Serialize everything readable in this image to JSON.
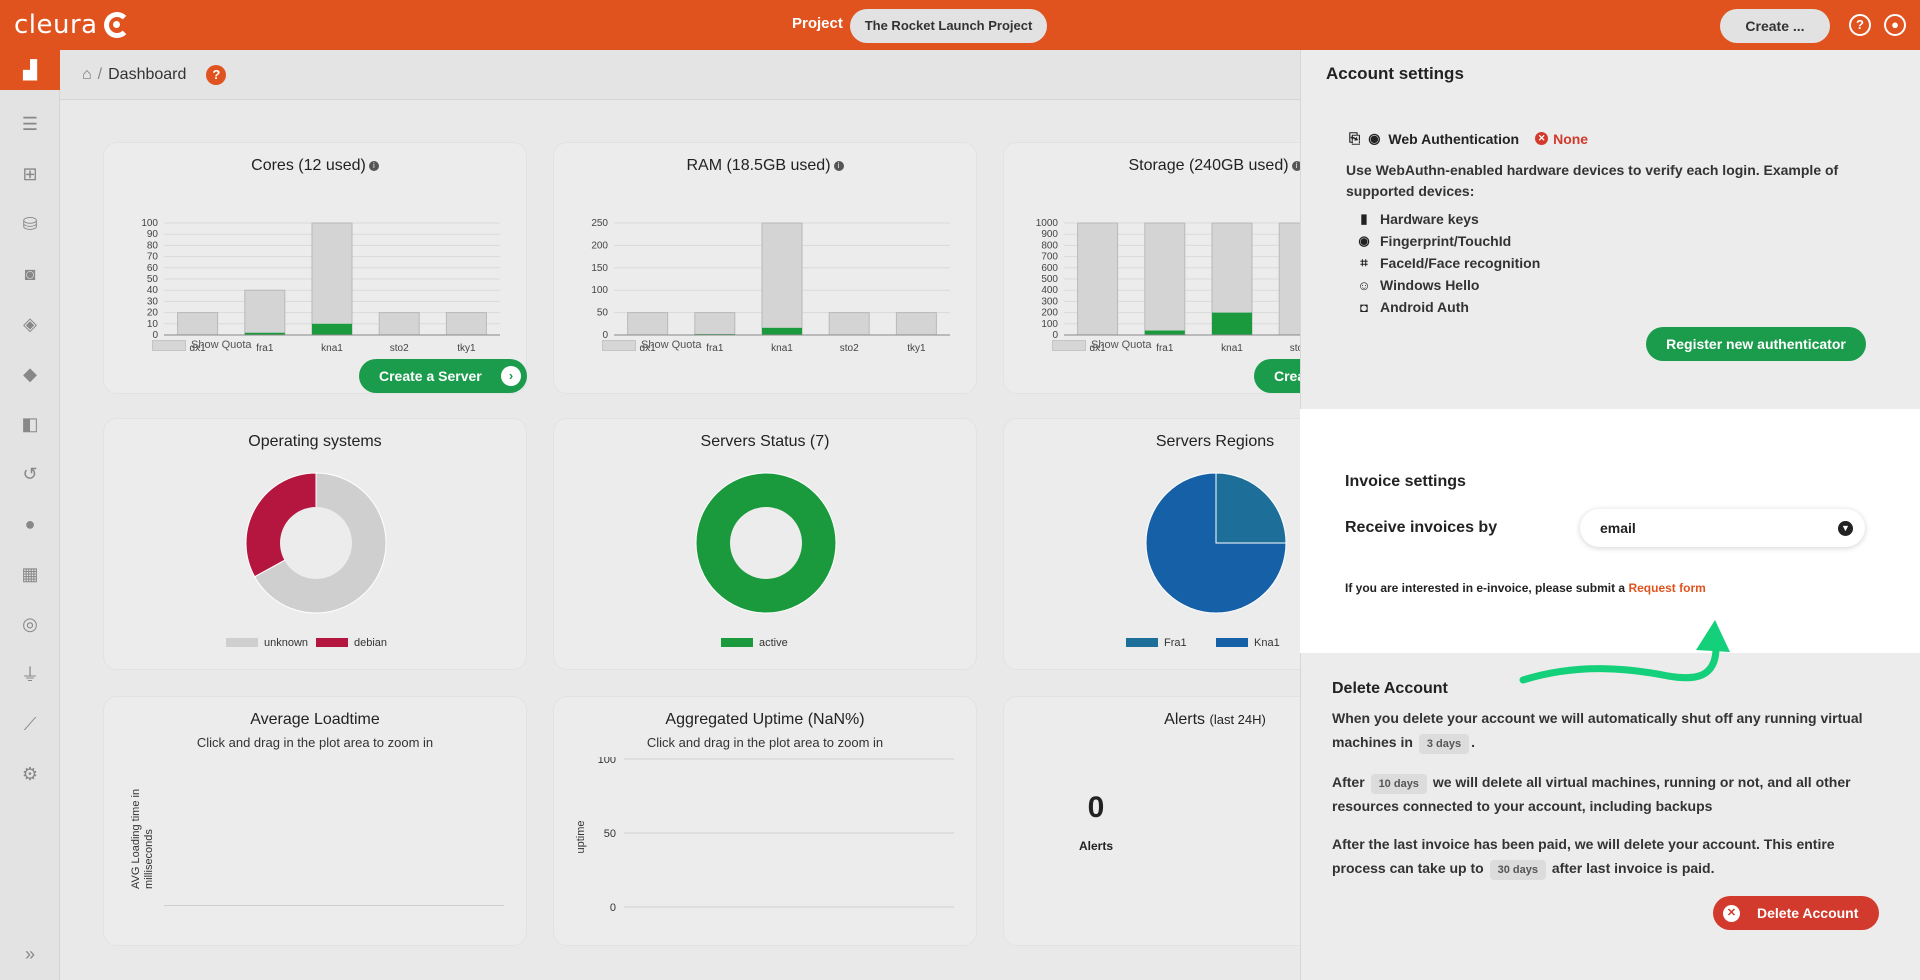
{
  "brand": {
    "name": "cleura",
    "accent": "#e0531f",
    "green": "#1b9c4d",
    "red": "#d13a2c"
  },
  "topbar": {
    "project_label": "Project",
    "project_name": "The Rocket Launch Project",
    "create_label": "Create ...",
    "icons": [
      "question-icon",
      "user-icon"
    ]
  },
  "sidebar": {
    "items": [
      {
        "icon": "dashboard-chart-icon",
        "active": true
      },
      {
        "icon": "servers-icon"
      },
      {
        "icon": "network-icon"
      },
      {
        "icon": "database-icon"
      },
      {
        "icon": "camera-icon"
      },
      {
        "icon": "shield-icon"
      },
      {
        "icon": "layers-icon"
      },
      {
        "icon": "box-icon"
      },
      {
        "icon": "history-icon"
      },
      {
        "icon": "user-icon"
      },
      {
        "icon": "calculator-icon"
      },
      {
        "icon": "lifebuoy-icon"
      },
      {
        "icon": "plug-icon"
      },
      {
        "icon": "chart-line-icon"
      },
      {
        "icon": "gear-icon"
      }
    ],
    "expand_icon": "double-chevron-right-icon"
  },
  "header": {
    "breadcrumb_sep": "/",
    "title": "Dashboard",
    "help": "?"
  },
  "cards": {
    "cores_title": "Cores (12 used)",
    "ram_title": "RAM (18.5GB used)",
    "storage_title": "Storage (240GB used)",
    "show_quota": "Show Quota",
    "create_server": "Create a Server",
    "os_title": "Operating systems",
    "os_legend": [
      "unknown",
      "debian"
    ],
    "status_title": "Servers Status (7)",
    "status_legend": [
      "active"
    ],
    "regions_title": "Servers Regions",
    "regions_legend": [
      "Fra1",
      "Kna1"
    ],
    "loadtime_title": "Average Loadtime",
    "zoom_hint": "Click and drag in the plot area to zoom in",
    "loadtime_ylabel": "AVG Loading time in milliseconds",
    "uptime_title": "Aggregated Uptime (NaN%)",
    "uptime_ylabel": "uptime",
    "alerts_title": "Alerts",
    "alerts_suffix": "(last 24H)",
    "alerts_value": "0",
    "alerts_label": "Alerts"
  },
  "chart_data": [
    {
      "type": "bar",
      "title": "Cores (12 used)",
      "categories": [
        "dx1",
        "fra1",
        "kna1",
        "sto2",
        "tky1"
      ],
      "series": [
        {
          "name": "Quota",
          "values": [
            20,
            40,
            100,
            20,
            20
          ]
        },
        {
          "name": "Used",
          "values": [
            0,
            2,
            10,
            0,
            0
          ]
        }
      ],
      "yticks": [
        0,
        10,
        20,
        30,
        40,
        50,
        60,
        70,
        80,
        90,
        100
      ],
      "ylim": [
        0,
        100
      ]
    },
    {
      "type": "bar",
      "title": "RAM (18.5GB used)",
      "categories": [
        "dx1",
        "fra1",
        "kna1",
        "sto2",
        "tky1"
      ],
      "series": [
        {
          "name": "Quota",
          "values": [
            50,
            50,
            250,
            50,
            50
          ]
        },
        {
          "name": "Used",
          "values": [
            0,
            2,
            16,
            0,
            0
          ]
        }
      ],
      "yticks": [
        0,
        50,
        100,
        150,
        200,
        250
      ],
      "ylim": [
        0,
        250
      ]
    },
    {
      "type": "bar",
      "title": "Storage (240GB used)",
      "categories": [
        "dx1",
        "fra1",
        "kna1",
        "sto2"
      ],
      "series": [
        {
          "name": "Quota",
          "values": [
            1000,
            1000,
            1000,
            1000
          ]
        },
        {
          "name": "Used",
          "values": [
            0,
            40,
            200,
            0
          ]
        }
      ],
      "yticks": [
        0,
        100,
        200,
        300,
        400,
        500,
        600,
        700,
        800,
        900,
        1000
      ],
      "ylim": [
        0,
        1000
      ]
    },
    {
      "type": "pie",
      "title": "Operating systems",
      "labels": [
        "unknown",
        "debian"
      ],
      "values": [
        67,
        33
      ],
      "colors": [
        "#cfcfcf",
        "#b5163f"
      ]
    },
    {
      "type": "pie",
      "title": "Servers Status (7)",
      "labels": [
        "active"
      ],
      "values": [
        100
      ],
      "colors": [
        "#1a9a3d"
      ]
    },
    {
      "type": "pie",
      "title": "Servers Regions",
      "labels": [
        "Fra1",
        "Kna1"
      ],
      "values": [
        25,
        75
      ],
      "colors": [
        "#1d6f9a",
        "#1660a8"
      ]
    },
    {
      "type": "line",
      "title": "Aggregated Uptime (NaN%)",
      "ylabel": "uptime",
      "yticks": [
        0,
        50,
        100
      ]
    }
  ],
  "panel": {
    "title": "Account settings",
    "webauthn_title": "Web Authentication",
    "webauthn_status": "None",
    "webauthn_desc": "Use WebAuthn-enabled hardware devices to verify each login. Example of supported devices:",
    "devices": [
      {
        "label": "Hardware keys",
        "icon": "usb-key-icon"
      },
      {
        "label": "Fingerprint/TouchId",
        "icon": "fingerprint-icon"
      },
      {
        "label": "FaceId/Face recognition",
        "icon": "face-scan-icon"
      },
      {
        "label": "Windows Hello",
        "icon": "smile-icon"
      },
      {
        "label": "Android Auth",
        "icon": "android-icon"
      }
    ],
    "register_label": "Register new authenticator",
    "invoice": {
      "title": "Invoice settings",
      "receive_label": "Receive invoices by",
      "selected": "email",
      "note": "If you are interested in e-invoice, please submit a",
      "link": "Request form"
    },
    "delete": {
      "title": "Delete Account",
      "p1_a": "When you delete your account we will automatically shut off any running virtual machines in",
      "p1_days": "3 days",
      "p1_b": ".",
      "p2_a": "After",
      "p2_days": "10 days",
      "p2_b": "we will delete all virtual machines, running or not, and all other resources connected to your account, including backups",
      "p3_a": "After the last invoice has been paid, we will delete your account. This entire process can take up to",
      "p3_days": "30 days",
      "p3_b": "after last invoice is paid.",
      "button": "Delete Account"
    }
  }
}
